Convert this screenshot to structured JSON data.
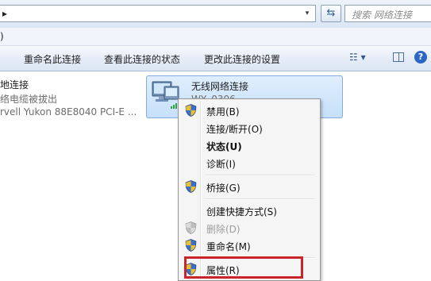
{
  "address_bar": {
    "path_arrow": "▸",
    "dropdown_arrow": "▾",
    "refresh_icon": "⇆"
  },
  "search": {
    "placeholder": "搜索 网络连接"
  },
  "menu_bar": {
    "visible_text": ")"
  },
  "command_bar": {
    "rename": "重命名此连接",
    "view_status": "查看此连接的状态",
    "change_settings": "更改此连接的设置",
    "view_toggle": "☷ ▾",
    "help": "?"
  },
  "connections": {
    "local": {
      "name": "地连接",
      "status": "络电缆被拔出",
      "device": "rvell Yukon 88E8040 PCI-E ..."
    },
    "wireless": {
      "name": "无线网络连接",
      "ssid": "WY_0306"
    }
  },
  "context_menu": {
    "items": [
      {
        "label": "禁用(B)",
        "icon": "shield-icon"
      },
      {
        "label": "连接/断开(O)"
      },
      {
        "label": "状态(U)",
        "bold": true
      },
      {
        "label": "诊断(I)"
      },
      {
        "label": "桥接(G)",
        "icon": "shield-icon"
      },
      {
        "label": "创建快捷方式(S)"
      },
      {
        "label": "删除(D)",
        "icon": "shield-icon",
        "disabled": true
      },
      {
        "label": "重命名(M)",
        "icon": "shield-icon"
      },
      {
        "label": "属性(R)",
        "icon": "shield-icon",
        "highlighted": true
      }
    ]
  },
  "colors": {
    "highlight": "#c8252c",
    "selection": "#c6e0fa"
  }
}
